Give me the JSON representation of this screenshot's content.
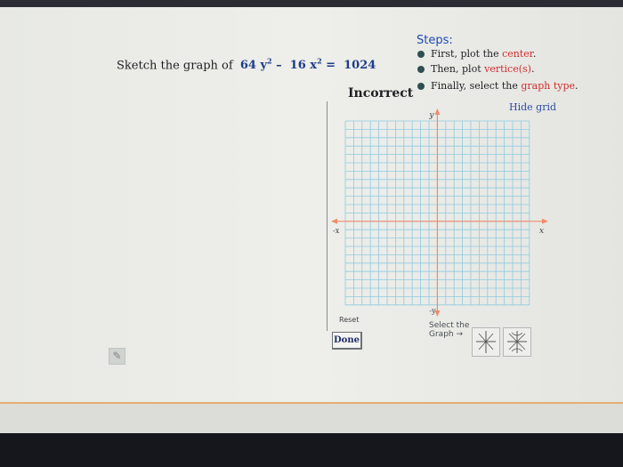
{
  "problem": {
    "prompt": "Sketch the graph of",
    "equation": {
      "t1": "64",
      "v1": "y",
      "e1": "2",
      "op": "–",
      "t2": "16",
      "v2": "x",
      "e2": "2",
      "eq": "=",
      "rhs": "1024"
    }
  },
  "feedback": "Incorrect",
  "steps": {
    "title": "Steps:",
    "items": [
      {
        "prefix": "First, plot the ",
        "highlight": "center",
        "suffix": "."
      },
      {
        "prefix": "Then, plot ",
        "highlight": "vertice(s)",
        "suffix": "."
      },
      {
        "prefix": "Finally, select the ",
        "highlight": "graph type",
        "suffix": "."
      }
    ]
  },
  "hide_grid_label": "Hide grid",
  "axes": {
    "y_label": "y",
    "x_label": "x",
    "neg_x_label": "-x",
    "neg_y_label": "-y"
  },
  "reset_label": "Reset",
  "done_label": "Done",
  "select_graph": {
    "line1": "Select the",
    "line2": "Graph →"
  },
  "graph_type_buttons": [
    {
      "icon": "ellipse-axes-icon"
    },
    {
      "icon": "hyperbola-axes-icon"
    }
  ],
  "colors": {
    "accent": "#1e4bb0",
    "highlight": "#d02d2d",
    "grid_line": "#8ecbe0",
    "axis": "#f08b6a"
  }
}
